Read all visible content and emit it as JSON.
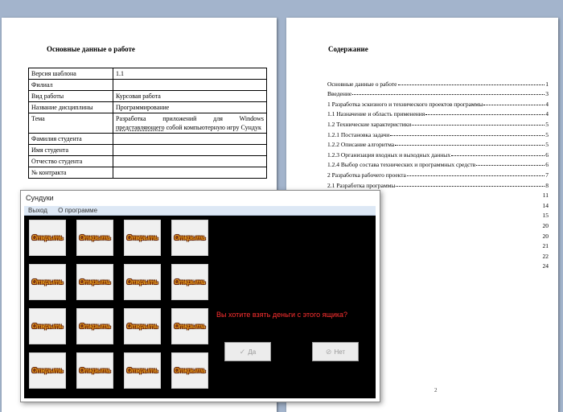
{
  "page1": {
    "title": "Основные данные о работе",
    "rows": [
      {
        "label": "Версия шаблона",
        "value": "1.1"
      },
      {
        "label": "Филиал",
        "value": ""
      },
      {
        "label": "Вид работы",
        "value": "Курсовая работа"
      },
      {
        "label": "Название дисциплины",
        "value": "Программирование"
      },
      {
        "label": "Тема",
        "value_pre": "Разработка приложений для Windows ",
        "value_underlined": "представляющего",
        "value_post": " собой компьютерную игру Сундук"
      },
      {
        "label": "Фамилия студента",
        "value": ""
      },
      {
        "label": "Имя студента",
        "value": ""
      },
      {
        "label": "Отчество студента",
        "value": ""
      },
      {
        "label": "№ контракта",
        "value": ""
      }
    ]
  },
  "page2": {
    "title": "Содержание",
    "toc": [
      {
        "text": "Основные данные о работе",
        "page": "1"
      },
      {
        "text": "Введение",
        "page": "3"
      },
      {
        "text": "1 Разработка эскизного и технического проектов программы",
        "page": "4"
      },
      {
        "text": "1.1 Назначение и область применения",
        "page": "4"
      },
      {
        "text": "1.2 Технические характеристики",
        "page": "5"
      },
      {
        "text": "1.2.1 Постановка задачи",
        "page": "5"
      },
      {
        "text": "1.2.2 Описание алгоритма",
        "page": "5"
      },
      {
        "text": "1.2.3 Организация входных и выходных данных",
        "page": "6"
      },
      {
        "text": "1.2.4 Выбор состава технических и программных средств",
        "page": "6"
      },
      {
        "text": "2 Разработка рабочего проекта",
        "page": "7"
      },
      {
        "text": "2.1 Разработка программы",
        "page": "8"
      },
      {
        "text": "",
        "page": "11"
      },
      {
        "text": "",
        "page": "14"
      },
      {
        "text": "",
        "page": "15"
      },
      {
        "text": "",
        "page": "20"
      },
      {
        "text": "",
        "page": "20"
      },
      {
        "text": "",
        "page": "21"
      },
      {
        "text": "",
        "page": "22"
      },
      {
        "text": "",
        "page": "24"
      }
    ],
    "page_number": "2"
  },
  "app": {
    "title": "Сундуки",
    "menu": [
      "Выход",
      "О программе"
    ],
    "box_label": "Открыть",
    "question": "Вы хотите взять деньги с этого ящика?",
    "yes_label": "Да",
    "no_label": "Нет",
    "colors": {
      "canvas": "#000000",
      "question": "#ff3030",
      "box_text": "#e8a020"
    }
  }
}
